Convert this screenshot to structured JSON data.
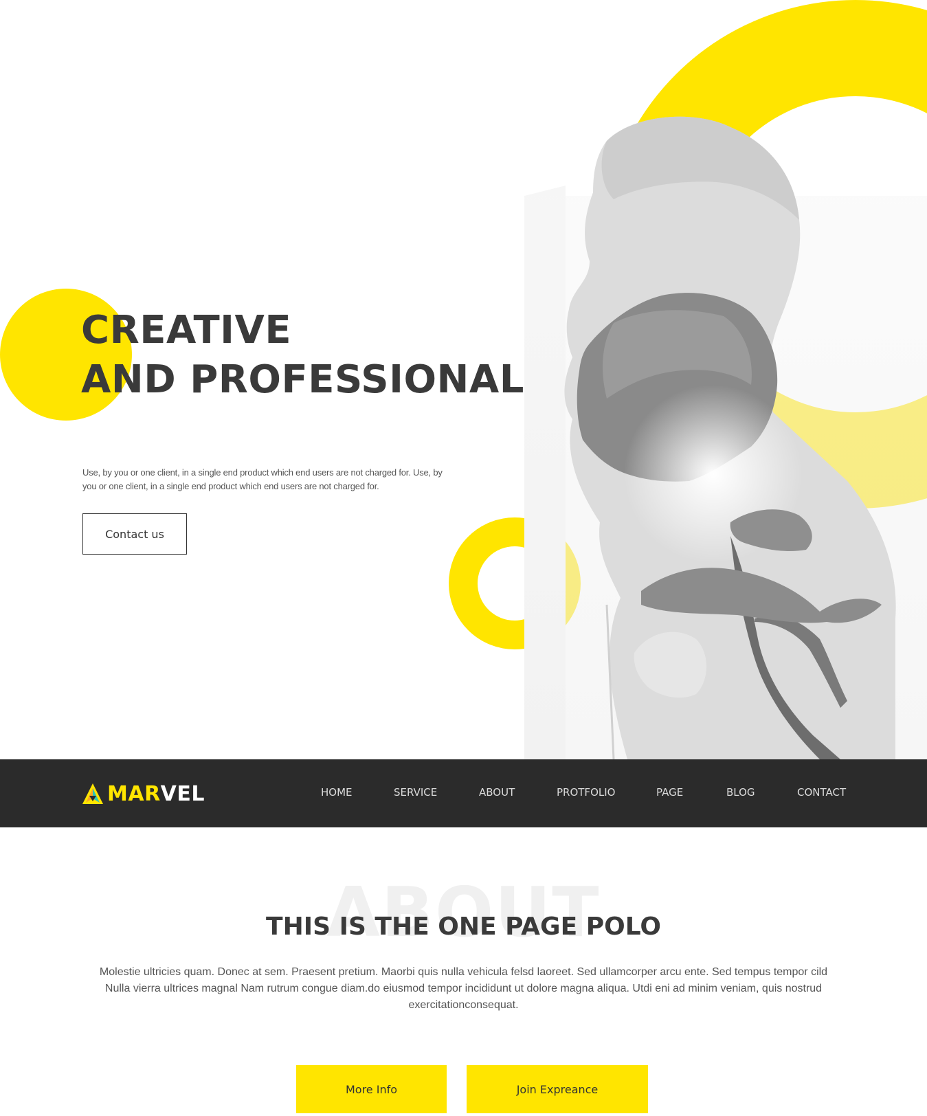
{
  "hero": {
    "title_line1": "CREATIVE",
    "title_line2": "AND PROFESSIONAL",
    "description": "Use, by you or one client, in a single end product which end users are not charged for. Use, by you or one client, in a single end product which end users are not charged for.",
    "contact_button": "Contact us"
  },
  "navbar": {
    "logo_part1": "MAR",
    "logo_part2": "VEL",
    "items": [
      "HOME",
      "SERVICE",
      "ABOUT",
      "PROTFOLIO",
      "PAGE",
      "BLOG",
      "CONTACT"
    ]
  },
  "about": {
    "background_word": "ABOUT",
    "title": "THIS IS THE ONE PAGE POLO",
    "text": "Molestie ultricies quam. Donec at sem. Praesent pretium. Maorbi quis nulla vehicula felsd laoreet. Sed ullamcorper arcu ente. Sed tempus tempor cild Nulla vierra ultrices magnal Nam rutrum congue diam.do eiusmod tempor incididunt ut dolore magna aliqua. Utdi eni ad minim veniam, quis nostrud exercitationconsequat.",
    "more_info_button": "More Info",
    "join_button": "Join Expreance"
  },
  "colors": {
    "accent": "#ffe500",
    "navbar_bg": "#2b2b2b",
    "heading": "#3a3a3a"
  },
  "icons": {
    "logo": "marvel-logo-icon"
  }
}
